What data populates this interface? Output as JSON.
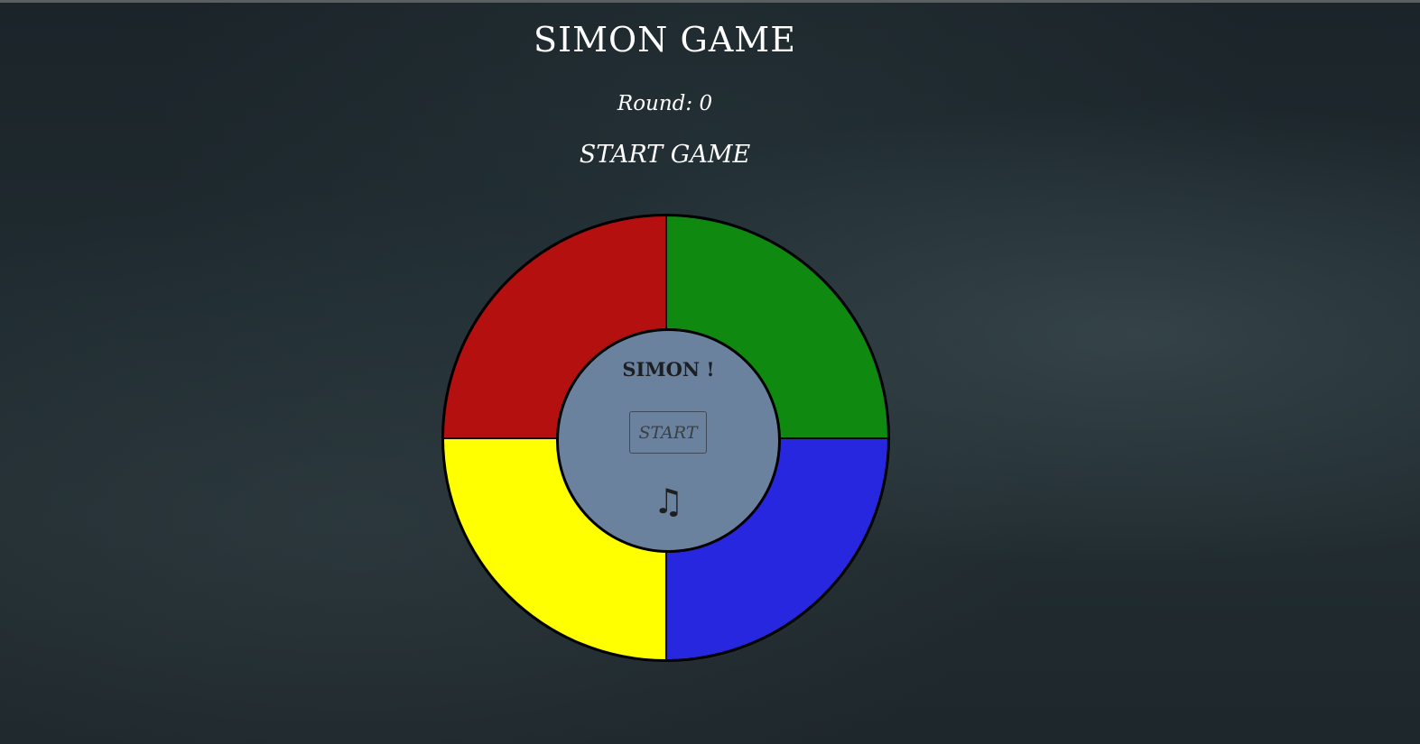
{
  "header": {
    "title": "SIMON GAME",
    "round_text": "Round: 0",
    "status_text": "START GAME"
  },
  "board": {
    "brand": "SIMON !",
    "start_label": "START",
    "music_icon": "♫",
    "colors": {
      "red": "#b41010",
      "green": "#0f890f",
      "yellow": "#ffff00",
      "blue": "#2727e0"
    }
  }
}
